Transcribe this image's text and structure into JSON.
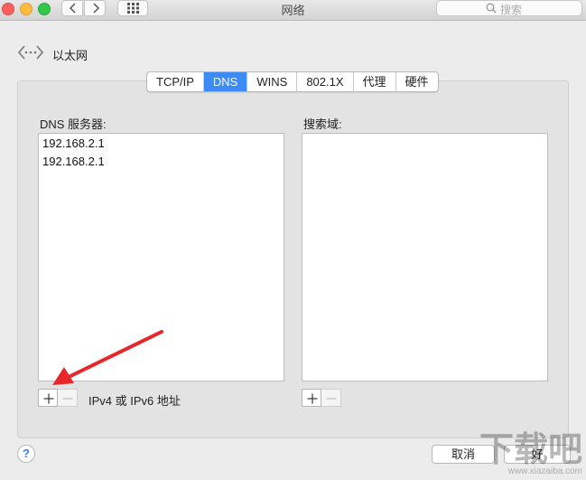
{
  "window": {
    "title": "网络",
    "search_placeholder": "搜索"
  },
  "header": {
    "connection_label": "以太网"
  },
  "tabs": [
    {
      "label": "TCP/IP",
      "active": false
    },
    {
      "label": "DNS",
      "active": true
    },
    {
      "label": "WINS",
      "active": false
    },
    {
      "label": "802.1X",
      "active": false
    },
    {
      "label": "代理",
      "active": false
    },
    {
      "label": "硬件",
      "active": false
    }
  ],
  "dns": {
    "section_label": "DNS 服务器:",
    "servers": [
      "192.168.2.1",
      "192.168.2.1"
    ],
    "hint": "IPv4 或 IPv6 地址"
  },
  "search_domains": {
    "section_label": "搜索域:",
    "items": []
  },
  "footer": {
    "help_label": "?",
    "cancel_label": "取消",
    "ok_label": "好"
  },
  "watermark": {
    "logo": "下载吧",
    "url": "www.xiazaiba.com"
  },
  "colors": {
    "accent": "#3d8bf7",
    "annotation_arrow": "#e8262a"
  }
}
